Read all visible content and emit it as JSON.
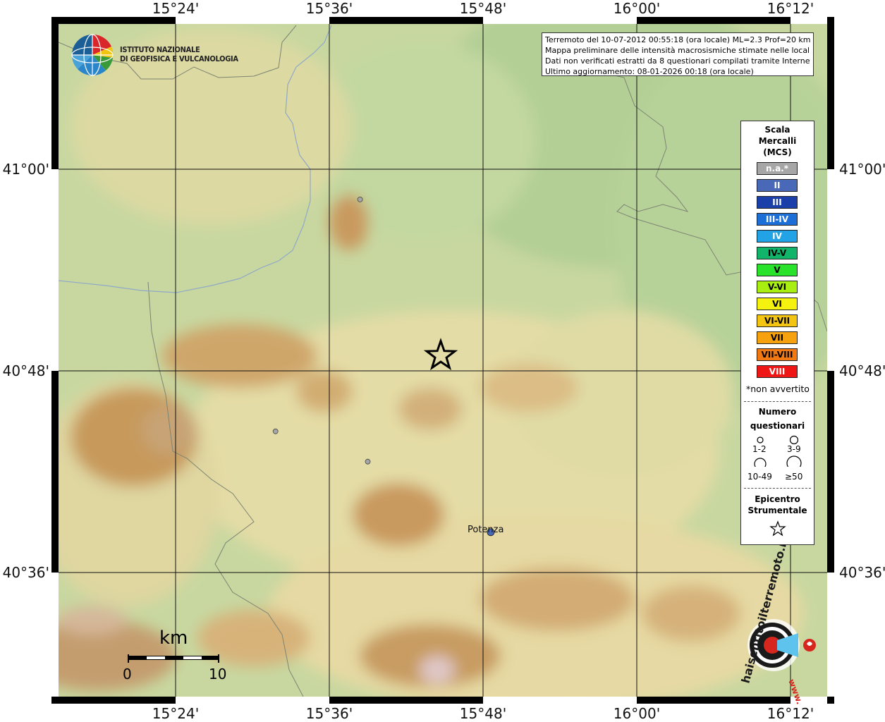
{
  "header": {
    "lines": [
      "Terremoto del 10-07-2012 00:55:18 (ora locale) ML=2.3 Prof=20 km",
      "Mappa preliminare delle intensità macrosismiche stimate nelle località",
      "Dati non verificati estratti da 8 questionari compilati tramite Internet.",
      "Ultimo aggiornamento: 08-01-2026 00:18 (ora locale)"
    ]
  },
  "logo": {
    "name_line1": "ISTITUTO NAZIONALE",
    "name_line2": "DI GEOFISICA E VULCANOLOGIA",
    "icon": "globe-logo-icon"
  },
  "axes": {
    "lon_ticks": [
      "15°24'",
      "15°36'",
      "15°48'",
      "16°00'",
      "16°12'"
    ],
    "lat_ticks": [
      "41°00'",
      "40°48'",
      "40°36'"
    ]
  },
  "legend": {
    "title_line1": "Scala",
    "title_line2": "Mercalli",
    "title_line3": "(MCS)",
    "classes": [
      {
        "label": "n.a.*",
        "color": "#a6a6a6",
        "text": "#ffffff"
      },
      {
        "label": "II",
        "color": "#4a68b8",
        "text": "#ffffff"
      },
      {
        "label": "III",
        "color": "#1a3fa8",
        "text": "#ffffff"
      },
      {
        "label": "III-IV",
        "color": "#1d6fd8",
        "text": "#ffffff"
      },
      {
        "label": "IV",
        "color": "#22a3e6",
        "text": "#ffffff"
      },
      {
        "label": "IV-V",
        "color": "#10b56a",
        "text": "#000000"
      },
      {
        "label": "V",
        "color": "#29e22a",
        "text": "#000000"
      },
      {
        "label": "V-VI",
        "color": "#a8ee10",
        "text": "#000000"
      },
      {
        "label": "VI",
        "color": "#f4f20e",
        "text": "#000000"
      },
      {
        "label": "VI-VII",
        "color": "#f3c410",
        "text": "#000000"
      },
      {
        "label": "VII",
        "color": "#f5a20e",
        "text": "#000000"
      },
      {
        "label": "VII-VIII",
        "color": "#f27812",
        "text": "#000000"
      },
      {
        "label": "VIII",
        "color": "#ef1616",
        "text": "#ffffff"
      }
    ],
    "not_felt_note": "*non avvertito",
    "count_title_line1": "Numero",
    "count_title_line2": "questionari",
    "count_labels": [
      "1-2",
      "3-9",
      "10-49",
      "≥50"
    ],
    "epicenter_title_line1": "Epicentro",
    "epicenter_title_line2": "Strumentale"
  },
  "places": [
    {
      "name": "Potenza",
      "lon": 15.81,
      "lat": 40.64,
      "intensity": "II",
      "color": "#4a68b8"
    }
  ],
  "points": [
    {
      "lon": 15.64,
      "lat": 40.97,
      "intensity": "n.a.*"
    },
    {
      "lon": 15.53,
      "lat": 40.74,
      "intensity": "n.a.*"
    },
    {
      "lon": 15.65,
      "lat": 40.71,
      "intensity": "n.a.*"
    }
  ],
  "epicenter": {
    "lon": 15.745,
    "lat": 40.815
  },
  "scalebar": {
    "unit": "km",
    "start": "0",
    "end": "10"
  },
  "haisentito_logo": {
    "text": "haisentitoilterremoto.it",
    "prefix": "www.",
    "icon": "seismograph-logo-icon"
  }
}
